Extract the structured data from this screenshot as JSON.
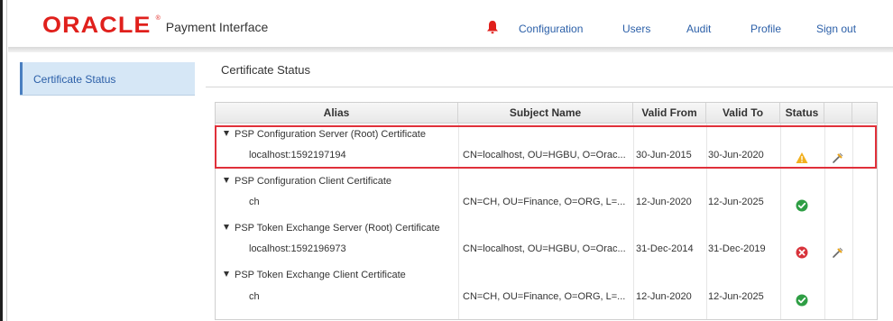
{
  "header": {
    "logo_text": "ORACLE",
    "logo_mark": "®",
    "product_name": "Payment Interface",
    "nav": {
      "configuration": "Configuration",
      "users": "Users",
      "audit": "Audit",
      "profile": "Profile",
      "sign_out": "Sign out"
    },
    "bell_icon": "bell-icon",
    "bell_color": "#e0201c"
  },
  "sidebar": {
    "items": [
      {
        "label": "Certificate Status",
        "active": true
      }
    ]
  },
  "main": {
    "title": "Certificate Status",
    "table": {
      "columns": [
        "Alias",
        "Subject Name",
        "Valid From",
        "Valid To",
        "Status",
        "",
        ""
      ],
      "groups": [
        {
          "name": "PSP Configuration Server (Root) Certificate",
          "alias": "localhost:1592197194",
          "subject": "CN=localhost, OU=HGBU, O=Orac...",
          "valid_from": "30-Jun-2015",
          "valid_to": "30-Jun-2020",
          "status": "warning",
          "editable": true
        },
        {
          "name": "PSP Configuration Client Certificate",
          "alias": "ch",
          "subject": "CN=CH, OU=Finance, O=ORG, L=...",
          "valid_from": "12-Jun-2020",
          "valid_to": "12-Jun-2025",
          "status": "valid",
          "editable": false
        },
        {
          "name": "PSP Token Exchange Server (Root) Certificate",
          "alias": "localhost:1592196973",
          "subject": "CN=localhost, OU=HGBU, O=Orac...",
          "valid_from": "31-Dec-2014",
          "valid_to": "31-Dec-2019",
          "status": "expired",
          "editable": true
        },
        {
          "name": "PSP Token Exchange Client Certificate",
          "alias": "ch",
          "subject": "CN=CH, OU=Finance, O=ORG, L=...",
          "valid_from": "12-Jun-2020",
          "valid_to": "12-Jun-2025",
          "status": "valid",
          "editable": false
        }
      ]
    }
  },
  "colors": {
    "brand_red": "#e0201c",
    "link_blue": "#2b5fa8",
    "sidebar_active_bg": "#d6e7f6",
    "status_valid": "#2e9e44",
    "status_warning": "#f2b01e",
    "status_expired": "#d8333b",
    "highlight_border": "#e0303a"
  }
}
